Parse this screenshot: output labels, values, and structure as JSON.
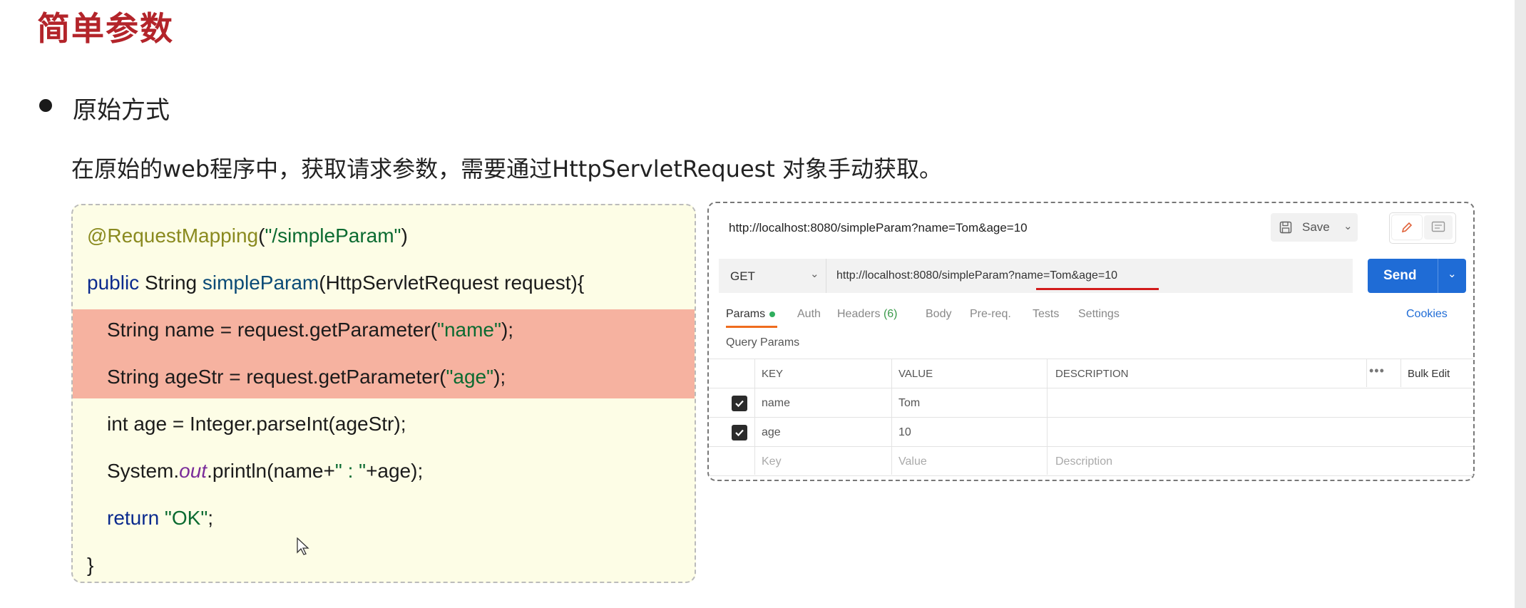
{
  "slide": {
    "title": "简单参数",
    "bullet": "原始方式",
    "description": "在原始的web程序中，获取请求参数，需要通过HttpServletRequest 对象手动获取。"
  },
  "code": {
    "line1_annotation": "@RequestMapping",
    "line1_paren_open": "(",
    "line1_string": "\"/simpleParam\"",
    "line1_paren_close": ")",
    "line2_keyword": "public",
    "line2_type": " String ",
    "line2_method": "simpleParam",
    "line2_rest": "(HttpServletRequest request){",
    "line3_text": "String name = request.getParameter(",
    "line3_string": "\"name\"",
    "line3_end": ");",
    "line4_text": "String ageStr = request.getParameter(",
    "line4_string": "\"age\"",
    "line4_end": ");",
    "line5_text": "int age = Integer.parseInt(ageStr);",
    "line6_prefix": "System.",
    "line6_field": "out",
    "line6_mid": ".println(name+",
    "line6_string": "\" : \"",
    "line6_end": "+age);",
    "line7_keyword": "return",
    "line7_string": " \"OK\"",
    "line7_end": ";",
    "line8": "}",
    "highlight_color": "#f6b2a0"
  },
  "postman": {
    "request_title": "http://localhost:8080/simpleParam?name=Tom&age=10",
    "save_label": "Save",
    "method": "GET",
    "url": "http://localhost:8080/simpleParam?name=Tom&age=10",
    "send_label": "Send",
    "tabs": {
      "params": "Params",
      "auth": "Auth",
      "headers": "Headers",
      "headers_count": "(6)",
      "body": "Body",
      "prereq": "Pre-req.",
      "tests": "Tests",
      "settings": "Settings"
    },
    "cookies_label": "Cookies",
    "query_params_label": "Query Params",
    "columns": {
      "key": "KEY",
      "value": "VALUE",
      "description": "DESCRIPTION",
      "more": "•••",
      "bulk_edit": "Bulk Edit"
    },
    "rows": [
      {
        "key": "name",
        "value": "Tom",
        "description": "",
        "checked": true
      },
      {
        "key": "age",
        "value": "10",
        "description": "",
        "checked": true
      }
    ],
    "placeholders": {
      "key": "Key",
      "value": "Value",
      "description": "Description"
    },
    "send_color": "#1f6cd6",
    "active_tab_color": "#ef6c1e",
    "underline_color": "#d21c1c"
  }
}
